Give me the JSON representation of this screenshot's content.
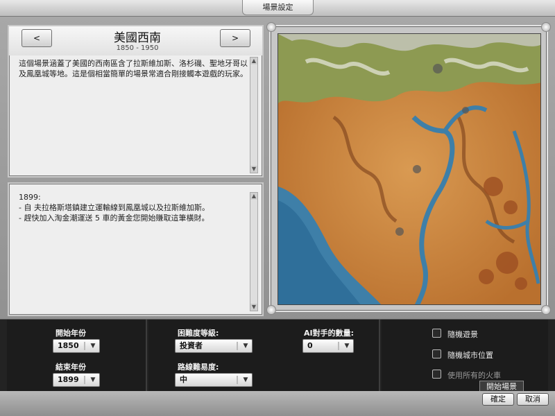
{
  "window": {
    "title": "場景設定"
  },
  "scenario": {
    "prev_label": "<",
    "next_label": ">",
    "name": "美國西南",
    "years": "1850 - 1950",
    "description": "這個場景涵蓋了美國的西南區含了拉斯維加斯、洛杉磯、聖地牙哥以及鳳凰城等地。這是個相當簡單的場景常適合剛接觸本遊戲的玩家。"
  },
  "goals": {
    "year": "1899:",
    "lines": [
      "- 自 夫拉格斯塔鎮建立運輸線到鳳凰城以及拉斯維加斯。",
      "- 趕快加入淘金潮運送 5 車的黃金您開始賺取這筆橫財。"
    ]
  },
  "settings": {
    "start_year_label": "開始年份",
    "start_year_value": "1850",
    "end_year_label": "結束年份",
    "end_year_value": "1899",
    "difficulty_label": "困難度等級:",
    "difficulty_value": "投資者",
    "track_label": "路線難易度:",
    "track_value": "中",
    "ai_label": "AI對手的數量:",
    "ai_value": "0",
    "random_scenario_label": "隨機遊景",
    "random_city_label": "隨機城市位置",
    "all_trains_label": "使用所有的火車"
  },
  "buttons": {
    "ok_label": "確定",
    "cancel_label": "取消",
    "tooltip": "開始場景"
  },
  "icons": {
    "prev": "chevron-left-icon",
    "next": "chevron-right-icon",
    "dropdown": "chevron-down-icon",
    "scroll_up": "scroll-up-icon",
    "scroll_down": "scroll-down-icon"
  },
  "colors": {
    "water": "#3e7fa8",
    "desert": "#c9843f",
    "panel": "#eeeeee",
    "bottom_bar": "#1c1c1c"
  }
}
